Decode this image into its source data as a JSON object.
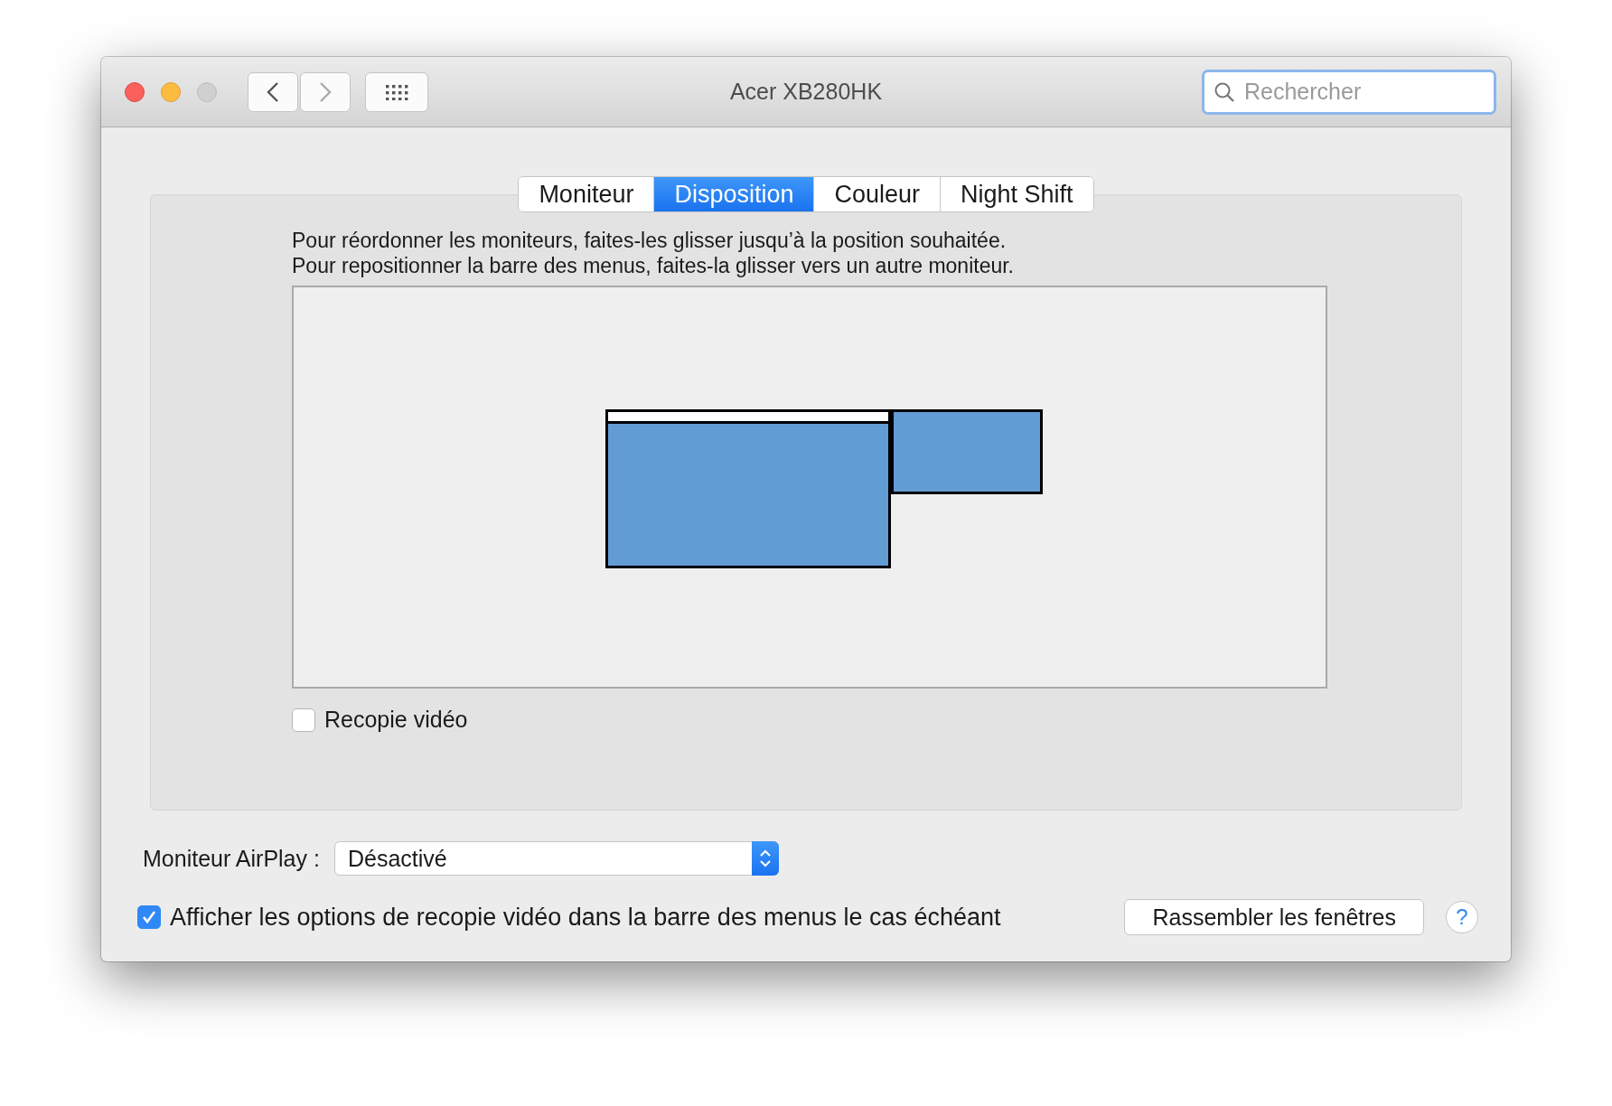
{
  "window": {
    "title": "Acer XB280HK"
  },
  "search": {
    "placeholder": "Rechercher"
  },
  "tabs": [
    {
      "label": "Moniteur",
      "selected": false
    },
    {
      "label": "Disposition",
      "selected": true
    },
    {
      "label": "Couleur",
      "selected": false
    },
    {
      "label": "Night Shift",
      "selected": false
    }
  ],
  "instructions": [
    "Pour réordonner les moniteurs, faites-les glisser jusqu’à la position souhaitée.",
    "Pour repositionner la barre des menus, faites-la glisser vers un autre moniteur."
  ],
  "displays": [
    {
      "menu_bar": true
    },
    {
      "menu_bar": false
    }
  ],
  "mirror_checkbox": {
    "label": "Recopie vidéo",
    "checked": false
  },
  "airplay": {
    "label": "Moniteur AirPlay :",
    "value": "Désactivé"
  },
  "menu_checkbox": {
    "label": "Afficher les options de recopie vidéo dans la barre des menus le cas échéant",
    "checked": true
  },
  "gather_button": "Rassembler les fenêtres",
  "help_button": "?"
}
